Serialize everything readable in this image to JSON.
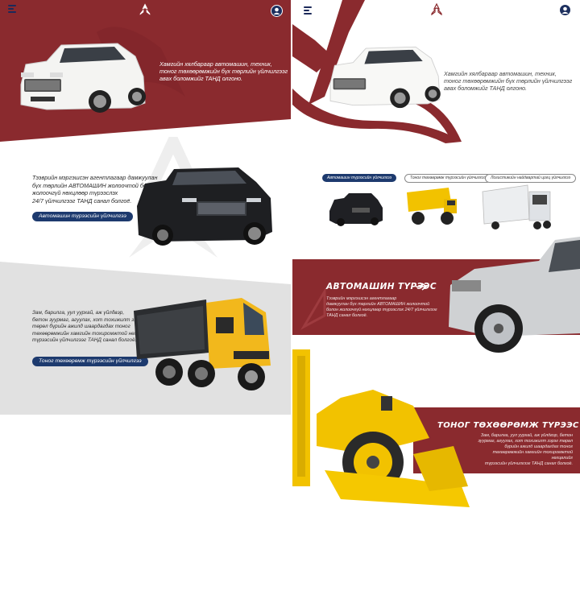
{
  "left": {
    "hero_text": [
      "Хамгийн хялбараар автомашин, техник,",
      "тоног төхөөрөмжийн бүх төрлийн үйлчилгээг",
      "авах боломжийг ТАНД олгоно."
    ],
    "section2_text": [
      "Тээврийн мэргэшсэн агентлагаар дамжуулан",
      "бүх төрлийн АВТОМАШИН жолоочтой болон",
      "жолоочгүй нөхцлөөр түрээслэх",
      "24/7 үйлчилгээг ТАНД санал болгоё."
    ],
    "section2_button": "Автомашин түрээсийн үйлчилгээ",
    "section3_text": [
      "Зам, барилга, уул уурхай, аж үйлдвэр,",
      "бетон зуурмаг, агуулах, хот тохижилт зэрэг",
      "төрөл бүрийн ажилд шаардагдах тоног",
      "төхөөрөмжийн хамгийн тохиромжтой нөхцөлийг",
      "түрээсийн үйлчилгээг ТАНД санал болгоё."
    ],
    "section3_button": "Тоног төхөөрөмж түрээсийн үйлчилгээ"
  },
  "right": {
    "hero_text": [
      "Хамгийн хялбараар автомашин, техник,",
      "тоног төхөөрөмжийн бүх төрлийн үйлчилгээг",
      "авах боломжийг ТАНД олгоно."
    ],
    "tabs": [
      "Автомашин түрээсийн үйлчилгээ",
      "Тоног төхөөрөмж түрээсийн үйлчилгээ",
      "Логистикийн найдвартай цогц үйлчилгээ"
    ],
    "car_rental_title": "АВТОМАШИН ТҮРЭЭС",
    "car_rental_text": [
      "Тээврийн мэргэшсэн агентлагаар",
      "дамжуулан бүх төрлийн АВТОМАШИН жолоочтой",
      "болон жолоочгүй нөхцлөөр түрээслэх 24/7 үйлчилгээг",
      "ТАНД санал болгоё."
    ],
    "equipment_title": "ТОНОГ ТӨХӨӨРӨМЖ ТҮРЭЭС",
    "equipment_text": [
      "Зам, барилга, уул уурхай, аж үйлдвэр, бетон",
      "зуурмаг, агуулах, хот тохижилт зэрэг төрөл",
      "бүрийн ажилд шаардагдах тоног",
      "төхөөрөмжийн хамгийн тохиромжтой нөхцөлийг",
      "түрээсийн үйлчилгээг ТАНД санал болгоё."
    ]
  },
  "colors": {
    "brand_red": "#8a2a2e",
    "navy": "#1d3a6e",
    "yellow": "#f2c200"
  }
}
